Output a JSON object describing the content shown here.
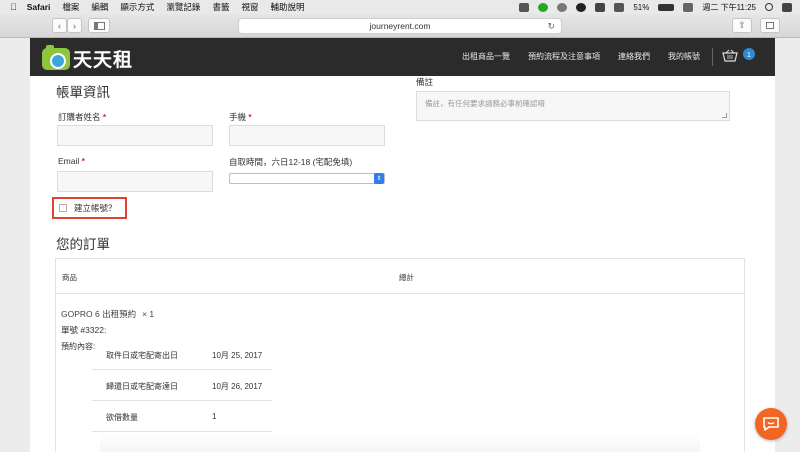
{
  "menubar": {
    "app_name": "Safari",
    "items": [
      "檔案",
      "編輯",
      "顯示方式",
      "瀏覽記錄",
      "書籤",
      "視窗",
      "輔助說明"
    ],
    "battery": "51%",
    "datetime": "週二 下午11:25"
  },
  "browser": {
    "url": "journeyrent.com"
  },
  "site": {
    "logo_text": "天天租",
    "nav": [
      "出租商品一覽",
      "預約流程及注意事項",
      "連絡我們",
      "我的帳號"
    ],
    "cart_count": "1"
  },
  "billing": {
    "heading": "帳單資訊",
    "name_label": "訂購者姓名",
    "phone_label": "手機",
    "email_label": "Email",
    "pickup_label": "自取時間，六日12-18 (宅配免填)",
    "required_mark": "*",
    "create_account_label": "建立帳號？",
    "notes_label": "備註",
    "notes_placeholder": "備註，有任何要求請務必事前確認唷"
  },
  "order": {
    "heading": "您的訂單",
    "col_product": "商品",
    "col_total": "總計",
    "product_name": "GOPRO 6 出租預約",
    "product_qty": "× 1",
    "order_number": "單號 #3322:",
    "booking_label": "預約內容:",
    "meta": [
      {
        "key": "取件日或宅配寄出日",
        "value": "10月 25, 2017"
      },
      {
        "key": "歸還日或宅配寄達日",
        "value": "10月 26, 2017"
      },
      {
        "key": "欲借數量",
        "value": "1"
      }
    ]
  },
  "colors": {
    "header_bg": "#2b2b2b",
    "accent_red": "#e0432f",
    "badge_blue": "#2d8bd6",
    "chat_orange": "#f26522"
  }
}
